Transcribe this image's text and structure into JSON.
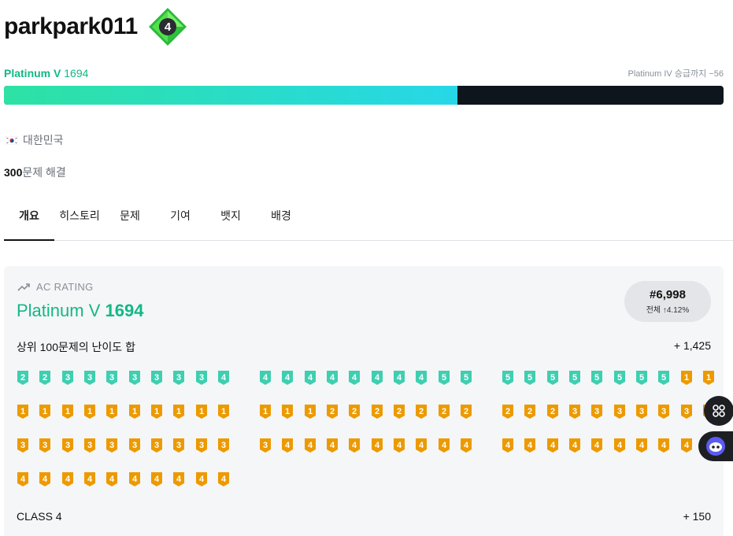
{
  "profile": {
    "username": "parkpark011",
    "class_level": "4",
    "tier_name": "Platinum V",
    "rating": "1694",
    "next_tier_text": "Platinum IV 승급까지 −56",
    "progress_percent": 63,
    "country": "대한민국",
    "solved_count": "300",
    "solved_suffix": "문제 해결"
  },
  "tabs": [
    {
      "label": "개요",
      "active": true
    },
    {
      "label": "히스토리",
      "active": false
    },
    {
      "label": "문제",
      "active": false
    },
    {
      "label": "기여",
      "active": false
    },
    {
      "label": "뱃지",
      "active": false
    },
    {
      "label": "배경",
      "active": false
    }
  ],
  "ac_rating": {
    "label": "AC RATING",
    "tier_name": "Platinum V",
    "rating": "1694",
    "rank": "#6,998",
    "rank_sub": "전체 ↑4.12%",
    "top100_label": "상위 100문제의 난이도 합",
    "top100_value": "+ 1,425",
    "class_label": "CLASS 4",
    "class_value": "+ 150"
  },
  "difficulty_rows": [
    [
      [
        "s",
        "2"
      ],
      [
        "s",
        "2"
      ],
      [
        "s",
        "3"
      ],
      [
        "s",
        "3"
      ],
      [
        "s",
        "3"
      ],
      [
        "s",
        "3"
      ],
      [
        "s",
        "3"
      ],
      [
        "s",
        "3"
      ],
      [
        "s",
        "3"
      ],
      [
        "s",
        "4"
      ],
      [
        "s",
        "4"
      ],
      [
        "s",
        "4"
      ],
      [
        "s",
        "4"
      ],
      [
        "s",
        "4"
      ],
      [
        "s",
        "4"
      ],
      [
        "s",
        "4"
      ],
      [
        "s",
        "4"
      ],
      [
        "s",
        "4"
      ],
      [
        "s",
        "5"
      ],
      [
        "s",
        "5"
      ],
      [
        "s",
        "5"
      ],
      [
        "s",
        "5"
      ],
      [
        "s",
        "5"
      ],
      [
        "s",
        "5"
      ],
      [
        "s",
        "5"
      ],
      [
        "s",
        "5"
      ],
      [
        "s",
        "5"
      ],
      [
        "s",
        "5"
      ],
      [
        "g",
        "1"
      ],
      [
        "g",
        "1"
      ]
    ],
    [
      [
        "g",
        "1"
      ],
      [
        "g",
        "1"
      ],
      [
        "g",
        "1"
      ],
      [
        "g",
        "1"
      ],
      [
        "g",
        "1"
      ],
      [
        "g",
        "1"
      ],
      [
        "g",
        "1"
      ],
      [
        "g",
        "1"
      ],
      [
        "g",
        "1"
      ],
      [
        "g",
        "1"
      ],
      [
        "g",
        "1"
      ],
      [
        "g",
        "1"
      ],
      [
        "g",
        "1"
      ],
      [
        "g",
        "2"
      ],
      [
        "g",
        "2"
      ],
      [
        "g",
        "2"
      ],
      [
        "g",
        "2"
      ],
      [
        "g",
        "2"
      ],
      [
        "g",
        "2"
      ],
      [
        "g",
        "2"
      ],
      [
        "g",
        "2"
      ],
      [
        "g",
        "2"
      ],
      [
        "g",
        "2"
      ],
      [
        "g",
        "3"
      ],
      [
        "g",
        "3"
      ],
      [
        "g",
        "3"
      ],
      [
        "g",
        "3"
      ],
      [
        "g",
        "3"
      ],
      [
        "g",
        "3"
      ],
      [
        "g",
        "3"
      ]
    ],
    [
      [
        "g",
        "3"
      ],
      [
        "g",
        "3"
      ],
      [
        "g",
        "3"
      ],
      [
        "g",
        "3"
      ],
      [
        "g",
        "3"
      ],
      [
        "g",
        "3"
      ],
      [
        "g",
        "3"
      ],
      [
        "g",
        "3"
      ],
      [
        "g",
        "3"
      ],
      [
        "g",
        "3"
      ],
      [
        "g",
        "3"
      ],
      [
        "g",
        "4"
      ],
      [
        "g",
        "4"
      ],
      [
        "g",
        "4"
      ],
      [
        "g",
        "4"
      ],
      [
        "g",
        "4"
      ],
      [
        "g",
        "4"
      ],
      [
        "g",
        "4"
      ],
      [
        "g",
        "4"
      ],
      [
        "g",
        "4"
      ],
      [
        "g",
        "4"
      ],
      [
        "g",
        "4"
      ],
      [
        "g",
        "4"
      ],
      [
        "g",
        "4"
      ],
      [
        "g",
        "4"
      ],
      [
        "g",
        "4"
      ],
      [
        "g",
        "4"
      ],
      [
        "g",
        "4"
      ],
      [
        "g",
        "4"
      ],
      [
        "g",
        "4"
      ]
    ],
    [
      [
        "g",
        "4"
      ],
      [
        "g",
        "4"
      ],
      [
        "g",
        "4"
      ],
      [
        "g",
        "4"
      ],
      [
        "g",
        "4"
      ],
      [
        "g",
        "4"
      ],
      [
        "g",
        "4"
      ],
      [
        "g",
        "4"
      ],
      [
        "g",
        "4"
      ],
      [
        "g",
        "4"
      ]
    ]
  ],
  "colors": {
    "platinum": "#12b886",
    "silver_icon": "#3ecfb0",
    "gold_icon": "#ec9a00",
    "progress_from": "#2de2a3",
    "progress_to": "#27d7e8",
    "progress_track": "#0f151c"
  },
  "icons": {
    "trend": "trending-up-icon",
    "class_badge": "class-diamond-icon",
    "apps": "apps-grid-icon",
    "bot": "chatbot-icon"
  }
}
